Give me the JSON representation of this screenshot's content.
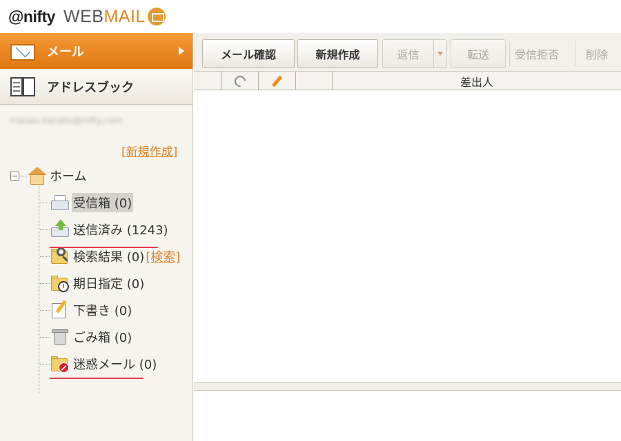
{
  "header": {
    "logo_at": "@nifty",
    "logo_web": "WEB",
    "logo_mail": "MAIL"
  },
  "sidebar": {
    "nav_mail": "メール",
    "nav_address": "アドレスブック",
    "account_email": "masao.kanato@nifty.com",
    "new_folder_link": "[新規作成]",
    "tree": {
      "home": "ホーム",
      "folders": [
        {
          "label": "受信箱 (0)",
          "icon": "inbox-tray-icon"
        },
        {
          "label": "送信済み (1243)",
          "icon": "sent-upload-icon"
        },
        {
          "label": "検索結果 (0)",
          "icon": "search-folder-icon"
        },
        {
          "label": "期日指定 (0)",
          "icon": "scheduled-folder-icon"
        },
        {
          "label": "下書き (0)",
          "icon": "draft-pencil-icon"
        },
        {
          "label": "ごみ箱 (0)",
          "icon": "trash-can-icon"
        },
        {
          "label": "迷惑メール (0)",
          "icon": "spam-folder-icon"
        }
      ],
      "search_link": "[検索]"
    }
  },
  "toolbar": {
    "check_mail": "メール確認",
    "new_mail": "新規作成",
    "reply": "返信",
    "forward": "転送",
    "block": "受信拒否",
    "delete": "削除"
  },
  "mail_list": {
    "columns": {
      "sender": "差出人"
    }
  },
  "colors": {
    "accent_orange": "#e27812",
    "link_orange": "#d9822b",
    "highlight_red": "#e53a4a"
  }
}
